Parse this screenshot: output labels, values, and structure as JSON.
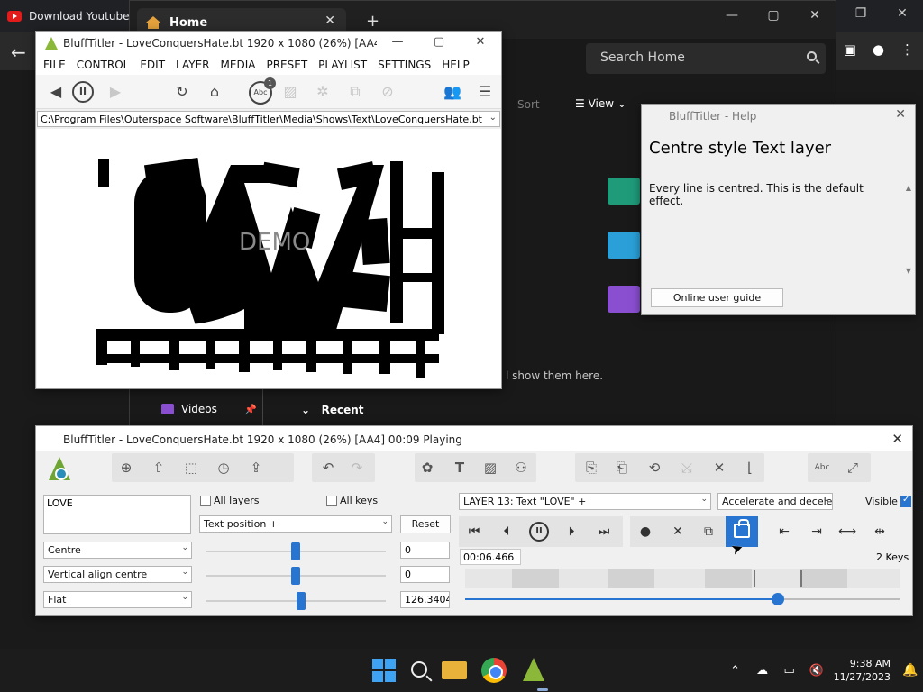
{
  "chrome": {
    "tab_title": "Download Youtube",
    "window_controls": [
      "—",
      "▢",
      "✕"
    ]
  },
  "explorer": {
    "tab_title": "Home",
    "search_placeholder": "Search Home",
    "sort_label": "Sort",
    "view_label": "View",
    "empty_text": "l show them here.",
    "nav_videos": "Videos",
    "recent_label": "Recent"
  },
  "bt_main": {
    "title": "BluffTitler - LoveConquersHate.bt 1920 x 1080 (26%) [AA4] 00:0...",
    "menu": [
      "FILE",
      "CONTROL",
      "EDIT",
      "LAYER",
      "MEDIA",
      "PRESET",
      "PLAYLIST",
      "SETTINGS",
      "HELP"
    ],
    "path": "C:\\Program Files\\Outerspace Software\\BluffTitler\\Media\\Shows\\Text\\LoveConquersHate.bt",
    "abc_count": "1",
    "abc_label": "Abc",
    "watermark": "DEMO"
  },
  "help": {
    "title": "BluffTitler - Help",
    "heading": "Centre style Text layer",
    "text": "Every line is centred. This is the default effect.",
    "button": "Online user guide"
  },
  "bt_ctrl": {
    "title": "BluffTitler - LoveConquersHate.bt 1920 x 1080 (26%) [AA4] 00:09 Playing",
    "text_content": "LOVE",
    "all_layers": "All layers",
    "all_keys": "All keys",
    "prop_dropdown": "Text position +",
    "reset": "Reset",
    "style_dropdown": "Centre",
    "valign_dropdown": "Vertical align centre",
    "shape_dropdown": "Flat",
    "value1": "0",
    "value2": "0",
    "value3": "126.34040",
    "layer_dropdown": "LAYER 13: Text \"LOVE\" +",
    "easing_dropdown": "Accelerate and decele",
    "visible_label": "Visible",
    "time": "00:06.466",
    "keys": "2 Keys",
    "slider_levels": [
      0.5,
      0.5,
      0.53
    ],
    "position_fraction": 0.72
  },
  "taskbar": {
    "time": "9:38 AM",
    "date": "11/27/2023"
  },
  "colors": {
    "accent": "#2774d1",
    "bt_green": "#8cb83a"
  }
}
